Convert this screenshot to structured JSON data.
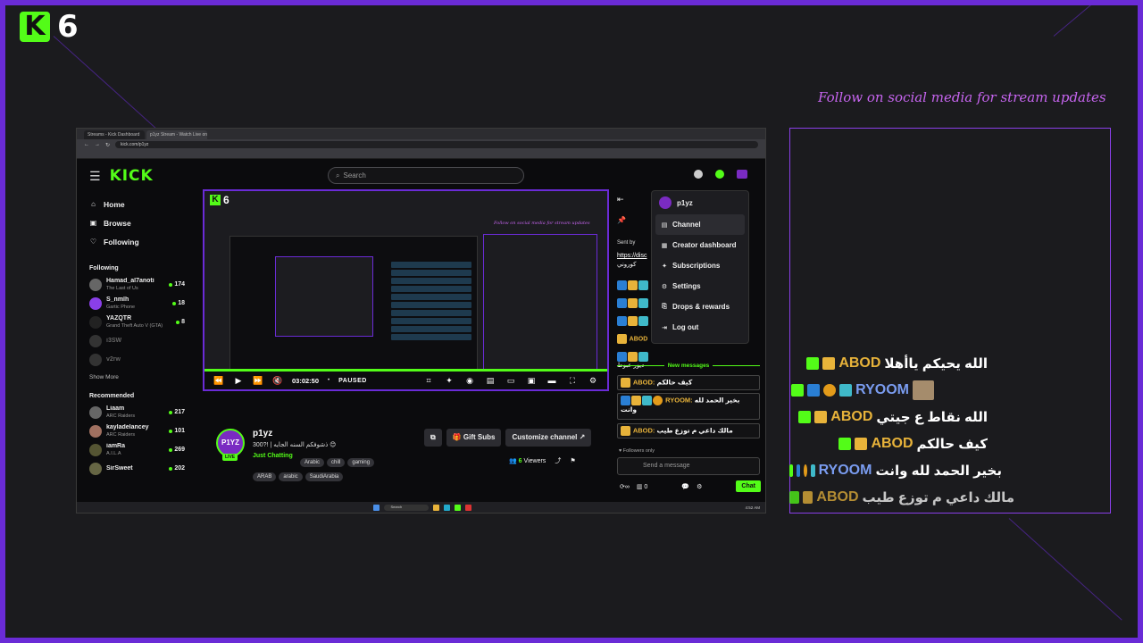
{
  "brand": {
    "logo_letter": "K",
    "logo_number": "6",
    "accent": "#53fc18",
    "frame_color": "#6a2bd6"
  },
  "social_banner": "Follow on social media for stream updates",
  "overlay_chat": [
    {
      "user": "ABOD",
      "message": "الله يحيكم ياأهلا"
    },
    {
      "user": "RYOOM",
      "message": ""
    },
    {
      "user": "ABOD",
      "message": "الله نقاط ع جيتي"
    },
    {
      "user": "ABOD",
      "message": "كيف حالكم"
    },
    {
      "user": "RYOOM",
      "message": "بخير الحمد لله وانت"
    },
    {
      "user": "ABOD",
      "message": "مالك داعي م توزع طيب"
    }
  ],
  "browser": {
    "tabs": [
      "Streams - Kick Dashboard",
      "p1yz Stream - Watch Live on Kick"
    ],
    "url": "kick.com/p1yz"
  },
  "kick": {
    "wordmark": "KICK",
    "search_placeholder": "Search",
    "nav": [
      {
        "label": "Home",
        "icon": "home-icon"
      },
      {
        "label": "Browse",
        "icon": "browse-icon"
      },
      {
        "label": "Following",
        "icon": "heart-icon"
      }
    ],
    "following_heading": "Following",
    "following": [
      {
        "name": "Hamad_al7anoti",
        "game": "The Last of Us",
        "viewers": "174"
      },
      {
        "name": "S_nmlh",
        "game": "Gartic Phone",
        "viewers": "18"
      },
      {
        "name": "YAZQTR",
        "game": "Grand Theft Auto V (GTA)",
        "viewers": "8"
      },
      {
        "name": "i3SW",
        "game": "",
        "viewers": ""
      },
      {
        "name": "v2rw",
        "game": "",
        "viewers": ""
      }
    ],
    "show_more": "Show More",
    "recommended_heading": "Recommended",
    "recommended": [
      {
        "name": "Liaam",
        "game": "ARC Raiders",
        "viewers": "217"
      },
      {
        "name": "kayladelancey",
        "game": "ARC Raiders",
        "viewers": "101"
      },
      {
        "name": "iamRa",
        "game": "A.I.L.A",
        "viewers": "269"
      },
      {
        "name": "SirSweet",
        "game": "",
        "viewers": "202"
      }
    ]
  },
  "player": {
    "time": "03:02:50",
    "state": "PAUSED"
  },
  "stream": {
    "avatar_text": "P1YZ",
    "live_label": "LIVE",
    "channel": "p1yz",
    "title": "300?! | ذشوفكم السنه الجايه 😊",
    "category": "Just Chatting",
    "tags1": [
      "Arabic",
      "chill",
      "gaming"
    ],
    "tags2": [
      "ARAB",
      "arabic",
      "SaudiArabia"
    ],
    "gift_subs": "Gift Subs",
    "customize": "Customize channel",
    "viewers_count": "6",
    "viewers_label": "Viewers"
  },
  "chat": {
    "sent_by": "Sent by",
    "link": "https://disc",
    "link_text": "كوروني",
    "partial": "ديور عبوط",
    "new_messages": "New messages",
    "messages": [
      {
        "user": "ABOD:",
        "text": "كيف حالكم"
      },
      {
        "user": "RYOOM:",
        "text": "بخير الحمد لله وانت"
      },
      {
        "user": "ABOD:",
        "text": "مالك داعي م توزع طيب"
      }
    ],
    "followers_only": "Followers only",
    "send_placeholder": "Send a message",
    "points": "0",
    "chat_button": "Chat"
  },
  "dropdown": {
    "user": "p1yz",
    "items": [
      {
        "label": "Channel",
        "icon": "channel-icon"
      },
      {
        "label": "Creator dashboard",
        "icon": "dashboard-icon"
      },
      {
        "label": "Subscriptions",
        "icon": "subscriptions-icon"
      },
      {
        "label": "Settings",
        "icon": "gear-icon"
      },
      {
        "label": "Drops & rewards",
        "icon": "gift-icon"
      },
      {
        "label": "Log out",
        "icon": "logout-icon"
      }
    ]
  },
  "taskbar": {
    "search": "Search",
    "time": "4:52 AM"
  }
}
